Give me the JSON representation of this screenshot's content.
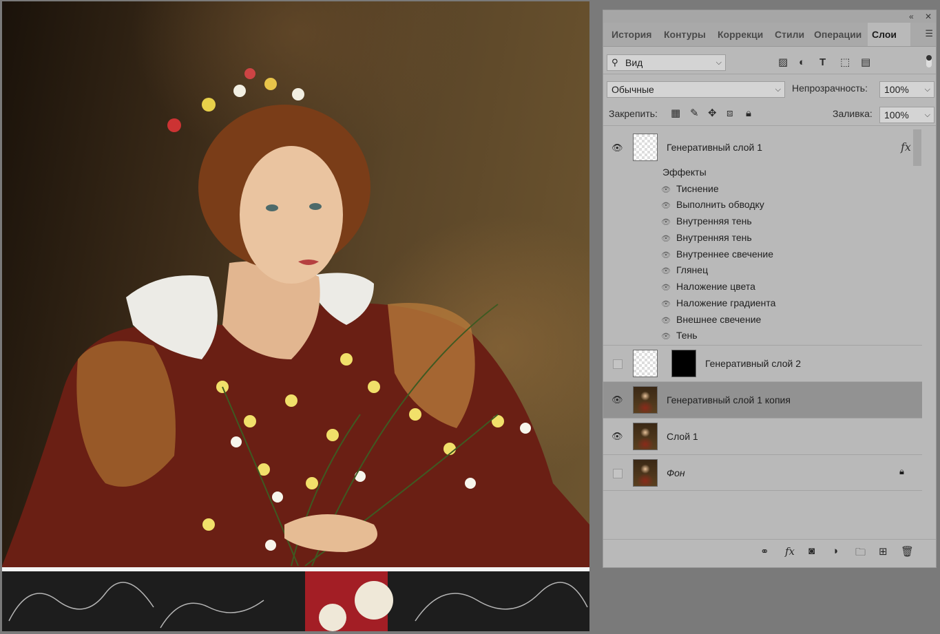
{
  "panel": {
    "topbar": {
      "collapse_glyph": "«",
      "close_glyph": "✕"
    },
    "tabs": [
      {
        "label": "История"
      },
      {
        "label": "Контуры"
      },
      {
        "label": "Коррекци"
      },
      {
        "label": "Стили"
      },
      {
        "label": "Операции"
      },
      {
        "label": "Слои",
        "active": true
      }
    ],
    "menu_icon": "☰",
    "filter": {
      "icon": "search-icon",
      "value": "Вид"
    },
    "blend_mode": "Обычные",
    "opacity_label": "Непрозрачность:",
    "opacity_value": "100%",
    "lock_label": "Закрепить:",
    "fill_label": "Заливка:",
    "fill_value": "100%",
    "layers": [
      {
        "name": "Генеративный слой 1",
        "visible": true,
        "fx": "fx",
        "effects_label": "Эффекты",
        "effects": [
          "Тиснение",
          "Выполнить обводку",
          "Внутренняя тень",
          "Внутренняя тень",
          "Внутреннее свечение",
          "Глянец",
          "Наложение цвета",
          "Наложение градиента",
          "Внешнее свечение",
          "Тень"
        ]
      },
      {
        "name": "Генеративный слой 2",
        "visible": false
      },
      {
        "name": "Генеративный слой 1 копия",
        "visible": true,
        "selected": true
      },
      {
        "name": "Слой 1",
        "visible": true
      },
      {
        "name": "Фон",
        "visible": false,
        "locked": true
      }
    ]
  },
  "colors": {
    "panel_bg": "#b9b9b9",
    "selected_layer": "#929292",
    "workspace": "#7a7a7a"
  }
}
